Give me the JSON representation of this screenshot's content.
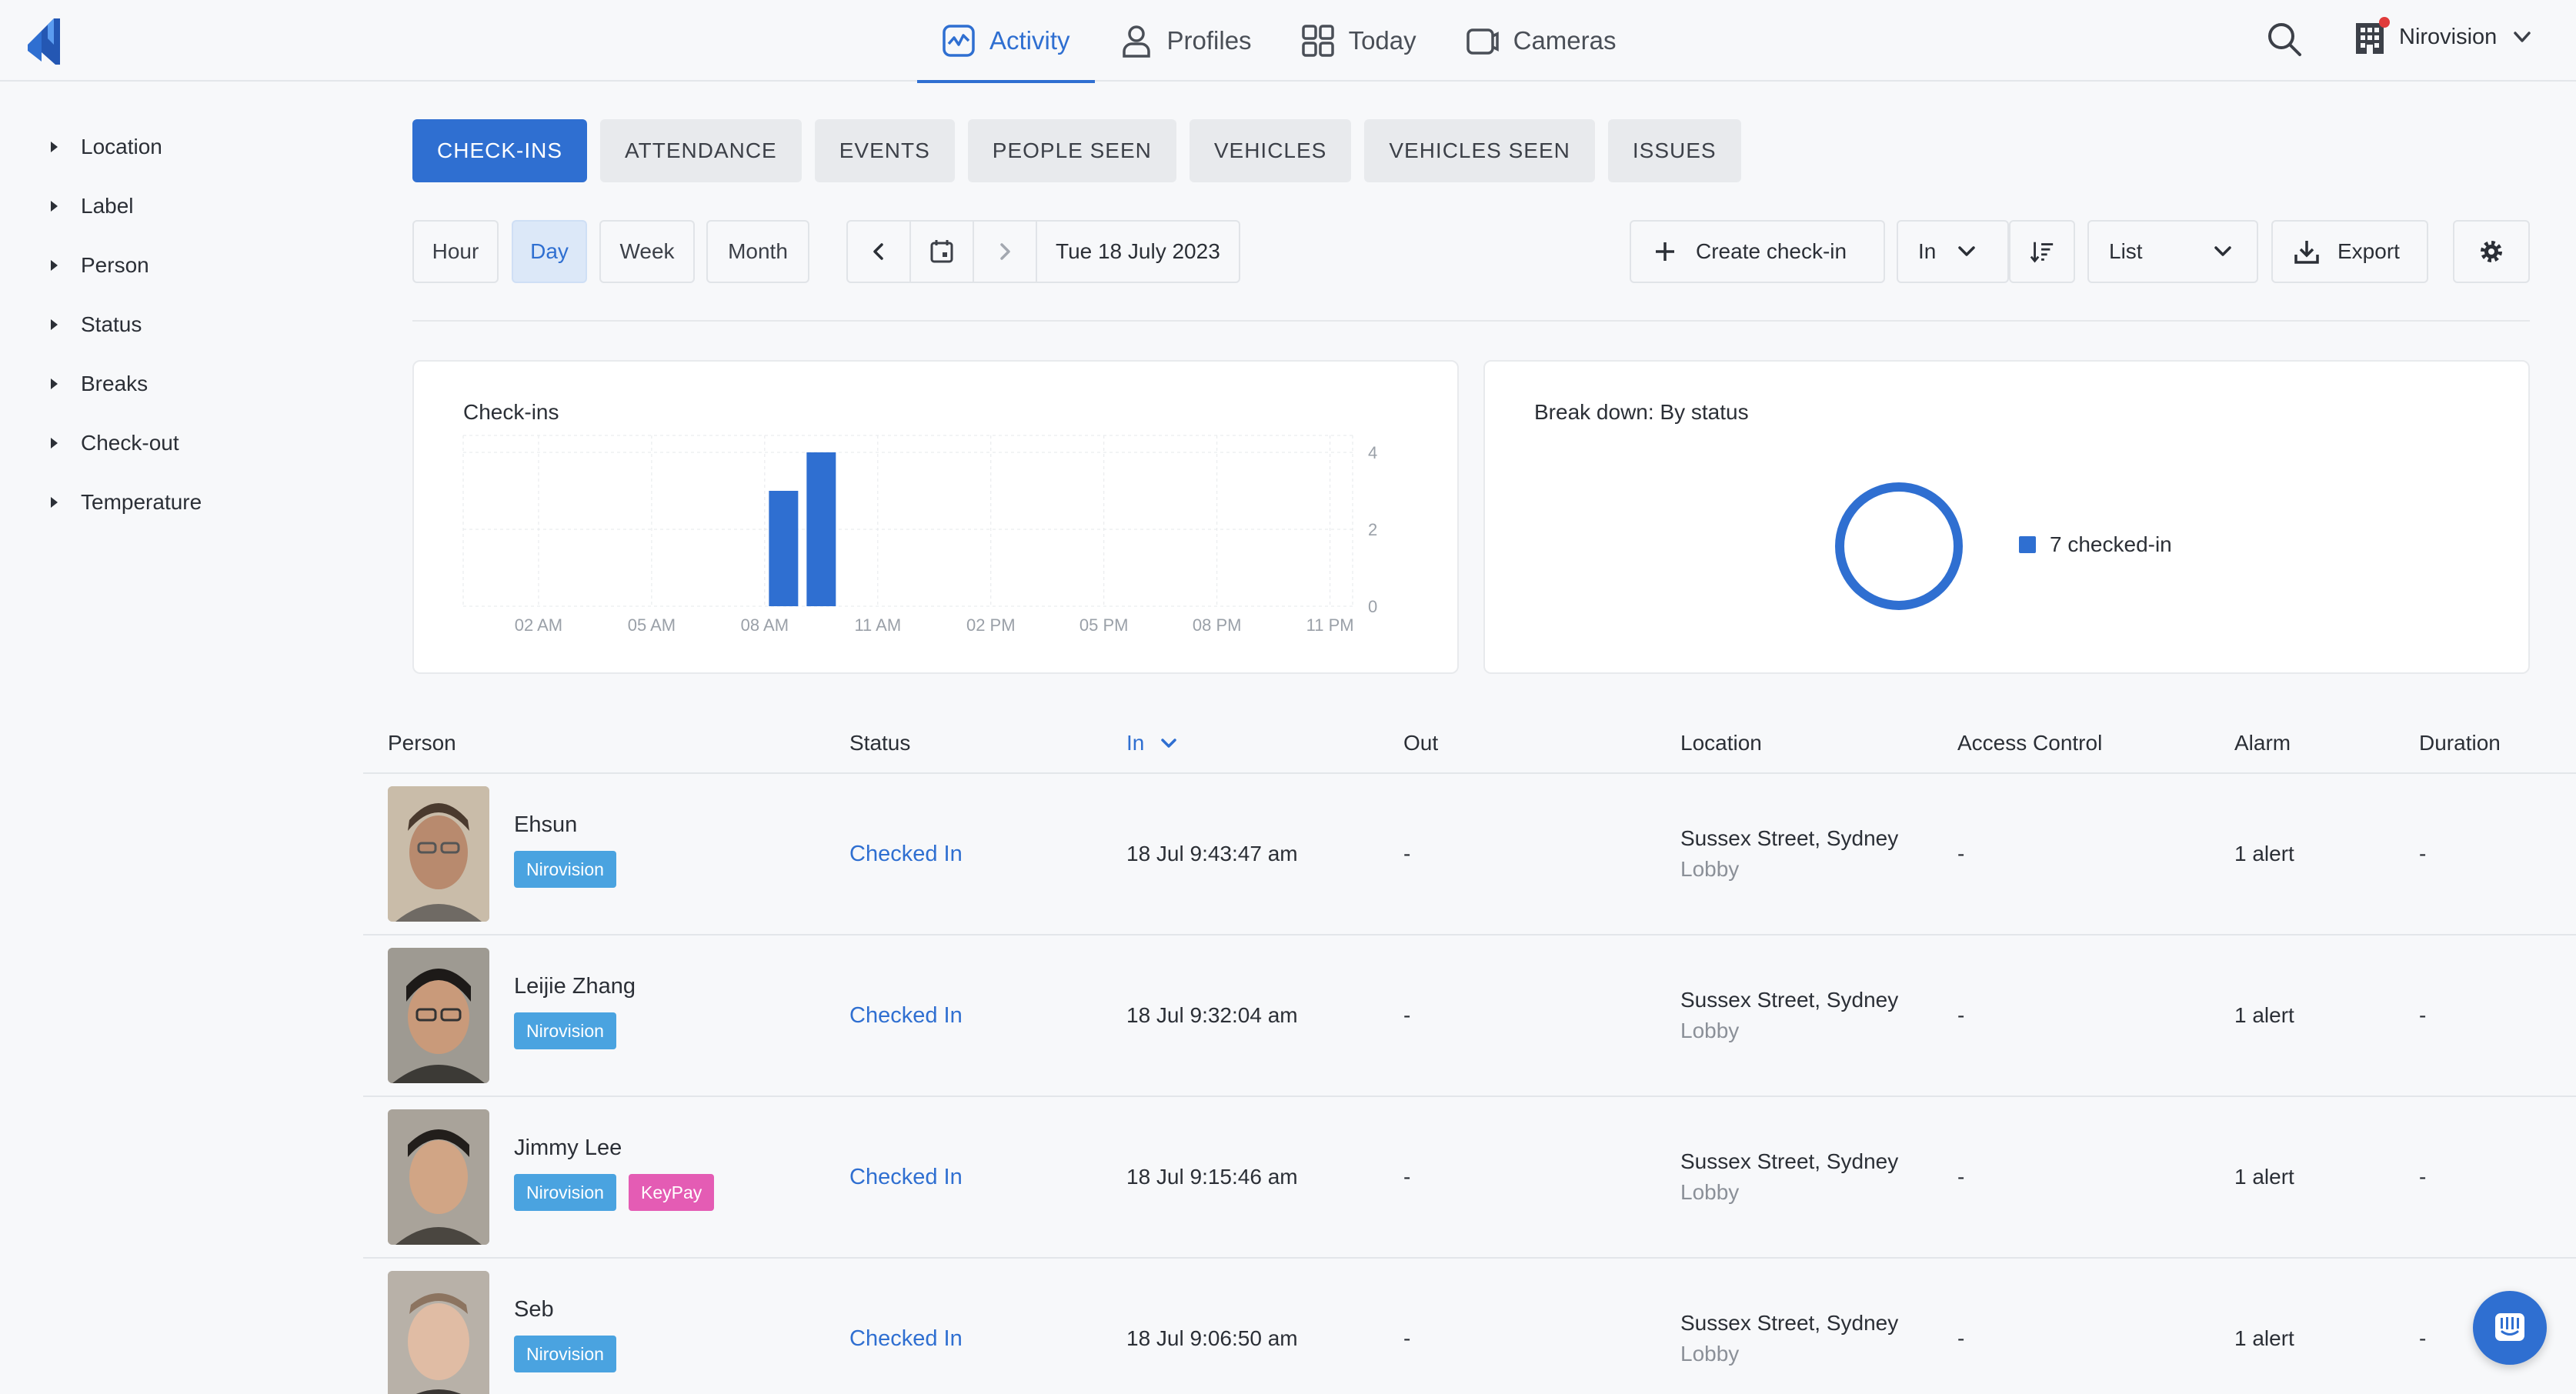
{
  "nav": {
    "tabs": [
      {
        "label": "Activity",
        "icon": "activity-icon"
      },
      {
        "label": "Profiles",
        "icon": "person-icon"
      },
      {
        "label": "Today",
        "icon": "grid-icon"
      },
      {
        "label": "Cameras",
        "icon": "camera-icon"
      }
    ],
    "active": "Activity",
    "org_name": "Nirovision"
  },
  "sidebar": {
    "filters": [
      "Location",
      "Label",
      "Person",
      "Status",
      "Breaks",
      "Check-out",
      "Temperature"
    ]
  },
  "tabs": {
    "items": [
      "CHECK-INS",
      "ATTENDANCE",
      "EVENTS",
      "PEOPLE SEEN",
      "VEHICLES",
      "VEHICLES SEEN",
      "ISSUES"
    ],
    "active": "CHECK-INS"
  },
  "toolbar": {
    "ranges": [
      "Hour",
      "Day",
      "Week",
      "Month"
    ],
    "active_range": "Day",
    "date": "Tue 18 July 2023",
    "create_label": "Create check-in",
    "direction": "In",
    "view": "List",
    "export_label": "Export"
  },
  "checkins_card": {
    "title": "Check-ins"
  },
  "breakdown_card": {
    "title": "Break down: By status",
    "legend": "7 checked-in"
  },
  "chart_data": [
    {
      "type": "bar",
      "title": "Check-ins",
      "x_ticks": [
        "02 AM",
        "05 AM",
        "08 AM",
        "11 AM",
        "02 PM",
        "05 PM",
        "08 PM",
        "11 PM"
      ],
      "y_ticks": [
        0,
        2,
        4
      ],
      "ylim": [
        0,
        4
      ],
      "bars": [
        {
          "hour": 8,
          "value": 3
        },
        {
          "hour": 9,
          "value": 4
        }
      ],
      "color": "#2f6fd1",
      "grid": true
    },
    {
      "type": "pie",
      "title": "Break down: By status",
      "slices": [
        {
          "label": "7 checked-in",
          "value": 7,
          "color": "#2f6fd1"
        }
      ]
    }
  ],
  "table": {
    "headers": {
      "person": "Person",
      "status": "Status",
      "in": "In",
      "out": "Out",
      "location": "Location",
      "access": "Access Control",
      "alarm": "Alarm",
      "duration": "Duration"
    },
    "rows": [
      {
        "name": "Ehsun",
        "badges": [
          {
            "label": "Nirovision",
            "color": "#4aa3e0"
          }
        ],
        "status": "Checked In",
        "in": "18 Jul 9:43:47 am",
        "out": "-",
        "location": "Sussex Street, Sydney",
        "sublocation": "Lobby",
        "access": "-",
        "alarm": "1 alert",
        "duration": "-"
      },
      {
        "name": "Leijie Zhang",
        "badges": [
          {
            "label": "Nirovision",
            "color": "#4aa3e0"
          }
        ],
        "status": "Checked In",
        "in": "18 Jul 9:32:04 am",
        "out": "-",
        "location": "Sussex Street, Sydney",
        "sublocation": "Lobby",
        "access": "-",
        "alarm": "1 alert",
        "duration": "-"
      },
      {
        "name": "Jimmy Lee",
        "badges": [
          {
            "label": "Nirovision",
            "color": "#4aa3e0"
          },
          {
            "label": "KeyPay",
            "color": "#e45cb4"
          }
        ],
        "status": "Checked In",
        "in": "18 Jul 9:15:46 am",
        "out": "-",
        "location": "Sussex Street, Sydney",
        "sublocation": "Lobby",
        "access": "-",
        "alarm": "1 alert",
        "duration": "-"
      },
      {
        "name": "Seb",
        "badges": [
          {
            "label": "Nirovision",
            "color": "#4aa3e0"
          }
        ],
        "status": "Checked In",
        "in": "18 Jul 9:06:50 am",
        "out": "-",
        "location": "Sussex Street, Sydney",
        "sublocation": "Lobby",
        "access": "-",
        "alarm": "1 alert",
        "duration": "-"
      }
    ]
  }
}
